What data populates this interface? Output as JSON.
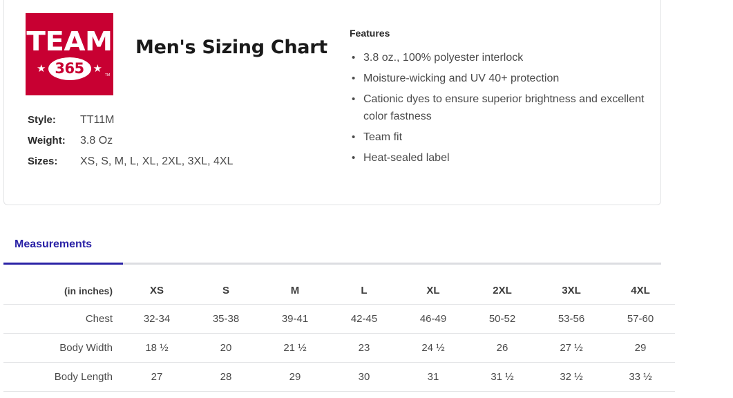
{
  "brand": {
    "logo_word": "TEAM",
    "logo_badge": "365",
    "logo_star_left": "★",
    "logo_star_right": "★",
    "logo_trademark": "TM",
    "logo_bg_color": "#c80032",
    "logo_fg_color": "#ffffff"
  },
  "header": {
    "title": "Men's Sizing Chart"
  },
  "specs": {
    "rows": [
      {
        "label": "Style:",
        "value": "TT11M"
      },
      {
        "label": "Weight:",
        "value": "3.8 Oz"
      },
      {
        "label": "Sizes:",
        "value": "XS, S, M, L, XL, 2XL, 3XL, 4XL"
      }
    ]
  },
  "features": {
    "heading": "Features",
    "items": [
      "3.8 oz., 100% polyester interlock",
      "Moisture-wicking and UV 40+ protection",
      "Cationic dyes to ensure superior brightness and excellent color fastness",
      "Team fit",
      "Heat-sealed label"
    ]
  },
  "tabs": {
    "active_index": 0,
    "active_color": "#2a22a6",
    "items": [
      {
        "label": "Measurements",
        "active": true
      }
    ]
  },
  "chart_data": {
    "type": "table",
    "title": "Measurements",
    "unit_header": "(in inches)",
    "categories": [
      "XS",
      "S",
      "M",
      "L",
      "XL",
      "2XL",
      "3XL",
      "4XL"
    ],
    "rows": [
      {
        "label": "Chest",
        "values": [
          "32-34",
          "35-38",
          "39-41",
          "42-45",
          "46-49",
          "50-52",
          "53-56",
          "57-60"
        ]
      },
      {
        "label": "Body Width",
        "values": [
          "18 ½",
          "20",
          "21 ½",
          "23",
          "24 ½",
          "26",
          "27 ½",
          "29"
        ]
      },
      {
        "label": "Body Length",
        "values": [
          "27",
          "28",
          "29",
          "30",
          "31",
          "31 ½",
          "32 ½",
          "33 ½"
        ]
      }
    ]
  }
}
